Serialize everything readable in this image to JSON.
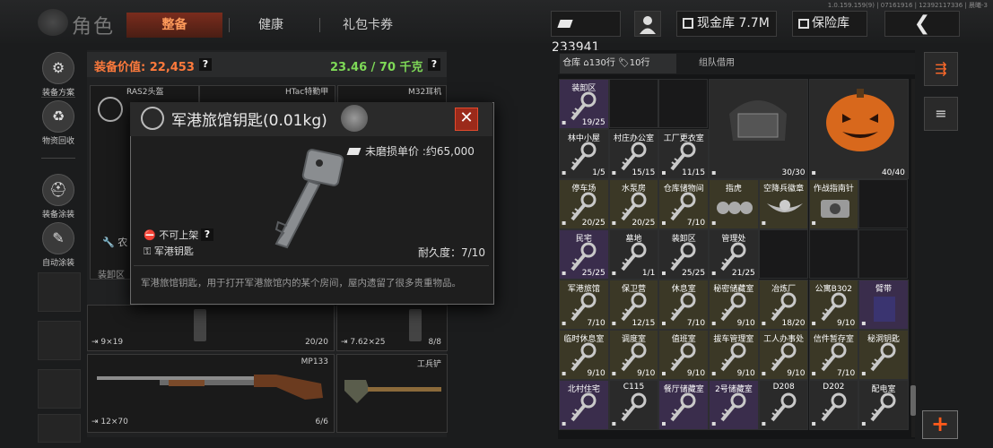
{
  "header": {
    "title": "角色",
    "tabs": [
      "整备",
      "健康",
      "礼包卡券"
    ],
    "version": "1.0.159.159(9) | 07161916 | 12392117336 | 晨曦-3",
    "money": "233941",
    "cash_label": "现金库",
    "cash_value": "7.7M",
    "insurance_label": "保险库",
    "back_glyph": "❮"
  },
  "sidebar": {
    "items": [
      {
        "label": "装备方案",
        "icon": "equipment-plan-icon"
      },
      {
        "label": "物资回收",
        "icon": "recycle-icon"
      },
      {
        "label": "装备涂装",
        "icon": "helmet-paint-icon"
      },
      {
        "label": "自动涂装",
        "icon": "auto-paint-icon"
      }
    ]
  },
  "equipment": {
    "value_label": "装备价值: 22,453",
    "weight_label": "23.46 / 70 千克",
    "question": "?",
    "back_cards": [
      "RAS2头盔",
      "HTac特勤甲",
      "M32耳机"
    ],
    "back_rows": [
      "农",
      "装卸区"
    ],
    "pistol_left_ammo": "9×19",
    "pistol_left_count": "20/20",
    "pistol_right_ammo": "7.62×25",
    "pistol_right_count": "8/8",
    "shotgun_name": "MP133",
    "shotgun_ammo": "12×70",
    "shotgun_count": "6/6",
    "shovel_name": "工兵铲"
  },
  "popup": {
    "title": "军港旅馆钥匙(0.01kg)",
    "price": "未磨损单价 :约65,000",
    "tag_unsellable": "不可上架",
    "question": "?",
    "tag_key": "军港钥匙",
    "durability": "耐久度：7/10",
    "description": "军港旅馆钥匙，用于打开军港旅馆内的某个房间，屋内遗留了很多贵重物品。",
    "close_glyph": "✕"
  },
  "stash": {
    "tab_warehouse": "仓库",
    "rows_a": "130行",
    "rows_b": "10行",
    "tab_team": "组队借用",
    "cells": [
      {
        "name": "装卸区",
        "count": "19/25",
        "color": "p",
        "kind": "key"
      },
      {
        "name": "",
        "count": "30/30",
        "color": "g",
        "kind": "helmet"
      },
      {
        "name": "",
        "count": "40/40",
        "color": "g",
        "kind": "pumpkin"
      },
      {
        "name": "林中小屋",
        "count": "1/5",
        "color": "g",
        "kind": "key"
      },
      {
        "name": "村庄办公室",
        "count": "15/15",
        "color": "g",
        "kind": "key"
      },
      {
        "name": "工厂更衣室",
        "count": "11/15",
        "color": "g",
        "kind": "key"
      },
      {
        "name": "停车场",
        "count": "20/25",
        "color": "k",
        "kind": "key"
      },
      {
        "name": "水泵房",
        "count": "20/25",
        "color": "k",
        "kind": "key"
      },
      {
        "name": "仓库储物间",
        "count": "7/10",
        "color": "k",
        "kind": "key"
      },
      {
        "name": "指虎",
        "count": "",
        "color": "k",
        "kind": "knuckle"
      },
      {
        "name": "空降兵徽章",
        "count": "",
        "color": "k",
        "kind": "badge"
      },
      {
        "name": "作战指南针",
        "count": "",
        "color": "k",
        "kind": "compass"
      },
      {
        "name": "民宅",
        "count": "25/25",
        "color": "p",
        "kind": "key"
      },
      {
        "name": "墓地",
        "count": "1/1",
        "color": "g",
        "kind": "key"
      },
      {
        "name": "装卸区",
        "count": "25/25",
        "color": "g",
        "kind": "key"
      },
      {
        "name": "管理处",
        "count": "21/25",
        "color": "g",
        "kind": "key"
      },
      {
        "name": "军港旅馆",
        "count": "7/10",
        "color": "k",
        "kind": "key"
      },
      {
        "name": "保卫营",
        "count": "12/15",
        "color": "k",
        "kind": "key"
      },
      {
        "name": "休息室",
        "count": "7/10",
        "color": "k",
        "kind": "key"
      },
      {
        "name": "秘密储藏室",
        "count": "9/10",
        "color": "k",
        "kind": "key"
      },
      {
        "name": "冶炼厂",
        "count": "18/20",
        "color": "k",
        "kind": "key"
      },
      {
        "name": "公寓B302",
        "count": "9/10",
        "color": "k",
        "kind": "key"
      },
      {
        "name": "臂带",
        "count": "",
        "color": "p",
        "kind": "armband"
      },
      {
        "name": "临时休息室",
        "count": "9/10",
        "color": "k",
        "kind": "key"
      },
      {
        "name": "调度室",
        "count": "9/10",
        "color": "k",
        "kind": "key"
      },
      {
        "name": "值班室",
        "count": "9/10",
        "color": "k",
        "kind": "key"
      },
      {
        "name": "拔车管理室",
        "count": "9/10",
        "color": "k",
        "kind": "key"
      },
      {
        "name": "工人办事处",
        "count": "9/10",
        "color": "k",
        "kind": "key"
      },
      {
        "name": "信件暂存室",
        "count": "7/10",
        "color": "k",
        "kind": "key"
      },
      {
        "name": "秘洞钥匙",
        "count": "",
        "color": "k",
        "kind": "key"
      },
      {
        "name": "北村住宅",
        "count": "",
        "color": "p",
        "kind": "key"
      },
      {
        "name": "C115",
        "count": "",
        "color": "g",
        "kind": "key"
      },
      {
        "name": "餐厅储藏室",
        "count": "",
        "color": "p",
        "kind": "key"
      },
      {
        "name": "2号储藏室",
        "count": "",
        "color": "p",
        "kind": "key"
      },
      {
        "name": "D208",
        "count": "",
        "color": "g",
        "kind": "key"
      },
      {
        "name": "D202",
        "count": "",
        "color": "g",
        "kind": "key"
      },
      {
        "name": "配电室",
        "count": "",
        "color": "g",
        "kind": "key"
      }
    ]
  },
  "right_buttons": {
    "plus": "+"
  }
}
